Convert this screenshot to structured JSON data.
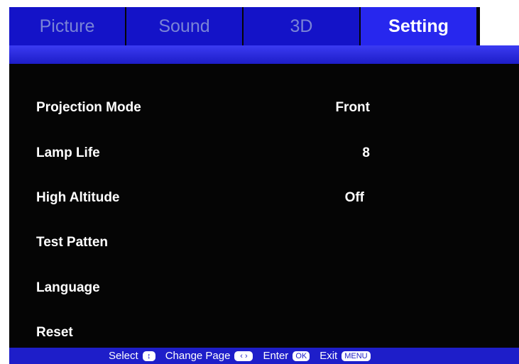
{
  "tabs": [
    {
      "label": "Picture",
      "active": false
    },
    {
      "label": "Sound",
      "active": false
    },
    {
      "label": "3D",
      "active": false
    },
    {
      "label": "Setting",
      "active": true
    }
  ],
  "menu": {
    "items": [
      {
        "label": "Projection Mode",
        "value": "Front"
      },
      {
        "label": "Lamp Life",
        "value": "8"
      },
      {
        "label": "High Altitude",
        "value": "Off"
      },
      {
        "label": "Test Patten",
        "value": ""
      },
      {
        "label": "Language",
        "value": ""
      },
      {
        "label": "Reset",
        "value": ""
      }
    ]
  },
  "footer": {
    "select_label": "Select",
    "select_key": "↕",
    "change_page_label": "Change Page",
    "change_page_key": "‹ ›",
    "enter_label": "Enter",
    "enter_key": "OK",
    "exit_label": "Exit",
    "exit_key": "MENU"
  },
  "colors": {
    "tab_bg": "#1413c8",
    "tab_active_bg": "#2727ee",
    "tab_text": "#7a84d6",
    "menu_bg": "#050505",
    "footer_bg": "#1e1ec9"
  }
}
